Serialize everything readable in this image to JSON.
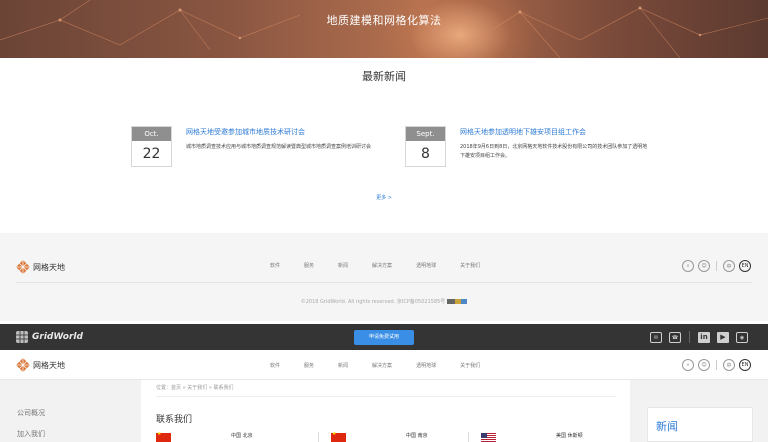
{
  "hero": {
    "title": "地质建模和网格化算法"
  },
  "news": {
    "heading": "最新新闻",
    "items": [
      {
        "month": "Oct.",
        "day": "22",
        "title": "网格天地受邀参加城市地质技术研讨会",
        "desc": "城市地质调查技术应用与城市地质调查规范解读暨典型城市地质调查案例培训研讨会"
      },
      {
        "month": "Sept.",
        "day": "8",
        "title": "网格天地参加透明地下雄安项目组工作会",
        "desc": "2018年9月6日到8日，北京网格天地软件技术股份有限公司的技术团队参加了透明地下雄安项目组工作会。"
      }
    ],
    "more": "更多 >"
  },
  "brand": {
    "name": "网格天地",
    "english": "GridWorld"
  },
  "nav": {
    "links": [
      "软件",
      "服务",
      "新闻",
      "解决方案",
      "透明地球",
      "关于我们"
    ],
    "lang_cn": "中",
    "lang_en": "EN"
  },
  "footer": {
    "copyright": "©2018 GridWorld. All rights reserved. 京ICP备05021585号"
  },
  "topbar": {
    "trial_button": "申请免费试用",
    "icons": [
      "mail-icon",
      "contact-card-icon",
      "linkedin-icon",
      "youtube-icon",
      "weibo-icon"
    ],
    "icon_glyphs": {
      "linkedin": "in",
      "youtube": "▶"
    }
  },
  "breadcrumb": "位置：首页 » 关于我们 » 联系我们",
  "sidebar": {
    "items": [
      "公司概况",
      "加入我们"
    ]
  },
  "contact": {
    "title": "联系我们",
    "offices": [
      {
        "flag": "cn",
        "city": "中国 北京"
      },
      {
        "flag": "cn",
        "city": "中国 南京"
      },
      {
        "flag": "us",
        "city": "美国 休斯顿"
      }
    ]
  },
  "right_panel": {
    "title": "新闻"
  },
  "colors": {
    "accent": "#2e7bd6",
    "button": "#3a8ee6",
    "topbar": "#343434",
    "logo_orange": "#d9783a"
  }
}
